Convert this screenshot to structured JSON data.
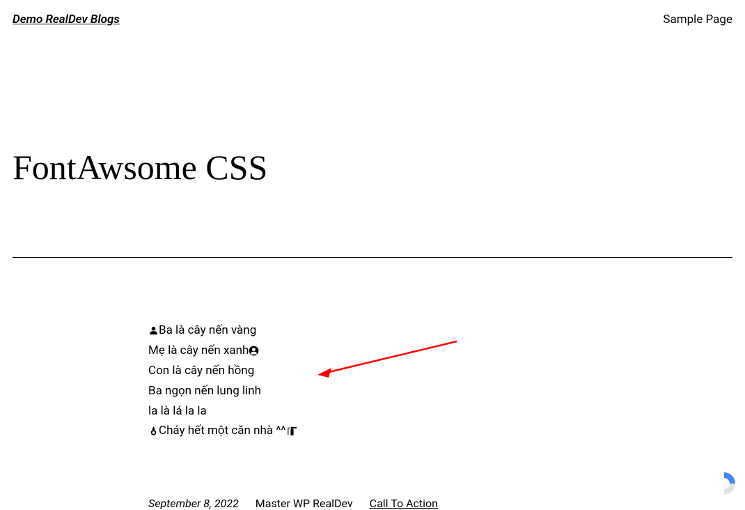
{
  "header": {
    "site_title": "Demo RealDev Blogs",
    "nav_link": "Sample Page"
  },
  "page": {
    "title": "FontAwsome CSS"
  },
  "content": {
    "lines": [
      {
        "icon_before": "user-icon",
        "text": "Ba là cây nến vàng",
        "icon_after": null
      },
      {
        "icon_before": null,
        "text": "Mẹ là cây nến xanh",
        "icon_after": "user-circle-icon"
      },
      {
        "icon_before": null,
        "text": "Con là cây nến hồng",
        "icon_after": null
      },
      {
        "icon_before": null,
        "text": "Ba ngọn nến lung linh",
        "icon_after": null
      },
      {
        "icon_before": null,
        "text": "la là lá la la",
        "icon_after": null
      },
      {
        "icon_before": "fire-icon",
        "text": "Cháy hết một căn nhà ^^",
        "icon_after": "fire-extinguisher-icon"
      }
    ]
  },
  "meta": {
    "date": "September 8, 2022",
    "author": "Master WP RealDev",
    "cta": "Call To Action"
  },
  "annotation": {
    "arrow_color": "#ff0000"
  }
}
